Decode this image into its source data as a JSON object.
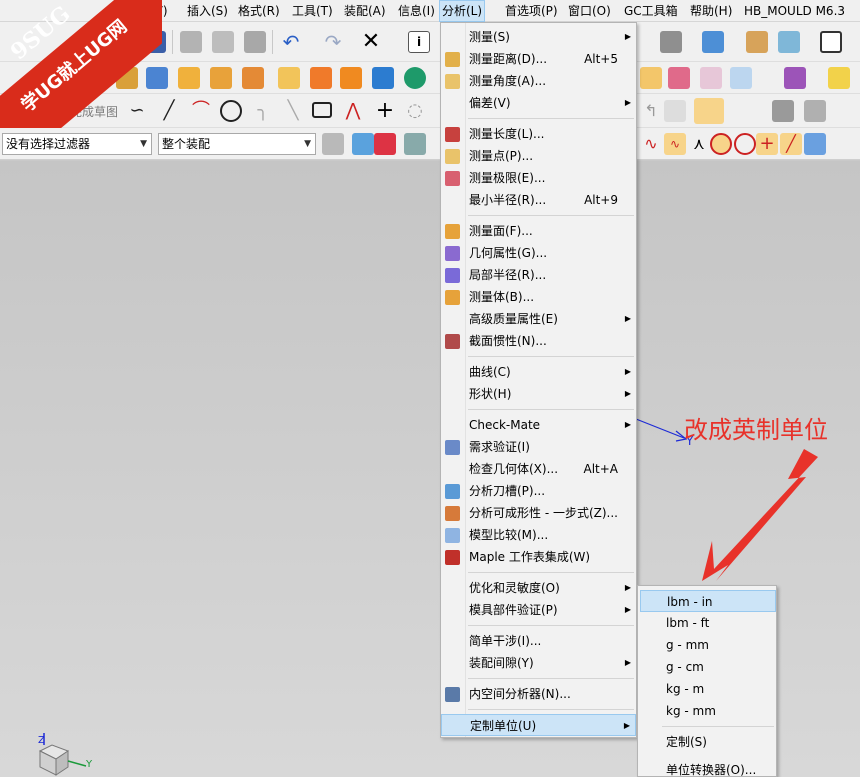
{
  "menubar": {
    "items": [
      {
        "label": "图(V)"
      },
      {
        "label": "插入(S)"
      },
      {
        "label": "格式(R)"
      },
      {
        "label": "工具(T)"
      },
      {
        "label": "装配(A)"
      },
      {
        "label": "信息(I)"
      },
      {
        "label": "分析(L)"
      },
      {
        "label": "首选项(P)"
      },
      {
        "label": "窗口(O)"
      },
      {
        "label": "GC工具箱"
      },
      {
        "label": "帮助(H)"
      },
      {
        "label": "HB_MOULD M6.3"
      }
    ]
  },
  "logo": {
    "line1": "9SUG",
    "line2": "学UG就上UG网"
  },
  "toolbar": {
    "finish_sketch": "完成草图",
    "filter_dropdown": "没有选择过滤器",
    "assembly_dropdown": "整个装配"
  },
  "analysis_menu": {
    "items": [
      {
        "label": "测量(S)",
        "shortcut": "",
        "submenu": true
      },
      {
        "label": "测量距离(D)...",
        "shortcut": "Alt+5"
      },
      {
        "label": "测量角度(A)...",
        "shortcut": ""
      },
      {
        "label": "偏差(V)",
        "shortcut": "",
        "submenu": true
      },
      {
        "label": "测量长度(L)...",
        "shortcut": ""
      },
      {
        "label": "测量点(P)...",
        "shortcut": ""
      },
      {
        "label": "测量极限(E)...",
        "shortcut": ""
      },
      {
        "label": "最小半径(R)...",
        "shortcut": "Alt+9"
      },
      {
        "label": "测量面(F)...",
        "shortcut": ""
      },
      {
        "label": "几何属性(G)...",
        "shortcut": ""
      },
      {
        "label": "局部半径(R)...",
        "shortcut": ""
      },
      {
        "label": "测量体(B)...",
        "shortcut": ""
      },
      {
        "label": "高级质量属性(E)",
        "shortcut": "",
        "submenu": true
      },
      {
        "label": "截面惯性(N)...",
        "shortcut": ""
      },
      {
        "label": "曲线(C)",
        "shortcut": "",
        "submenu": true
      },
      {
        "label": "形状(H)",
        "shortcut": "",
        "submenu": true
      },
      {
        "label": "Check-Mate",
        "shortcut": "",
        "submenu": true
      },
      {
        "label": "需求验证(I)",
        "shortcut": ""
      },
      {
        "label": "检查几何体(X)...",
        "shortcut": "Alt+A"
      },
      {
        "label": "分析刀槽(P)...",
        "shortcut": ""
      },
      {
        "label": "分析可成形性 - 一步式(Z)...",
        "shortcut": ""
      },
      {
        "label": "模型比较(M)...",
        "shortcut": ""
      },
      {
        "label": "Maple 工作表集成(W)",
        "shortcut": ""
      },
      {
        "label": "优化和灵敏度(O)",
        "shortcut": "",
        "submenu": true
      },
      {
        "label": "模具部件验证(P)",
        "shortcut": "",
        "submenu": true
      },
      {
        "label": "简单干涉(I)...",
        "shortcut": ""
      },
      {
        "label": "装配间隙(Y)",
        "shortcut": "",
        "submenu": true
      },
      {
        "label": "内空间分析器(N)...",
        "shortcut": ""
      },
      {
        "label": "定制单位(U)",
        "shortcut": "",
        "submenu": true
      }
    ]
  },
  "units_submenu": {
    "items": [
      {
        "label": "lbm - in"
      },
      {
        "label": "lbm - ft"
      },
      {
        "label": "g - mm"
      },
      {
        "label": "g - cm"
      },
      {
        "label": "kg - m"
      },
      {
        "label": "kg - mm"
      },
      {
        "label": "定制(S)"
      },
      {
        "label": "单位转换器(O)..."
      }
    ]
  },
  "annotation": {
    "text": "改成英制单位"
  },
  "triad": {
    "z": "Z",
    "y": "Y"
  },
  "colors": {
    "highlight": "#cce4f7",
    "annotation": "#e8322a",
    "logo_red": "#d92c1b"
  }
}
